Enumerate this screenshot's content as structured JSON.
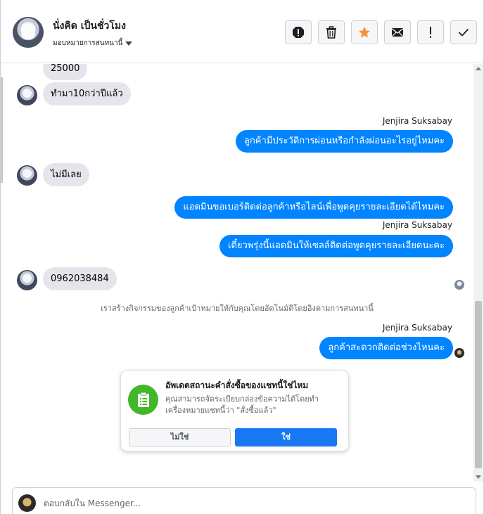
{
  "header": {
    "contact_name": "นั่งคิด เป็นชั่วโมง",
    "assign_label": "มอบหมายการสนทนานี้",
    "actions": [
      {
        "name": "spam-icon"
      },
      {
        "name": "trash-icon"
      },
      {
        "name": "star-icon",
        "color": "#f7923a"
      },
      {
        "name": "envelope-icon"
      },
      {
        "name": "exclamation-icon"
      },
      {
        "name": "checkmark-icon"
      }
    ]
  },
  "messages": [
    {
      "from": "customer",
      "text": "25000"
    },
    {
      "from": "customer",
      "text": "ทำมา10กว่าปีแล้ว"
    },
    {
      "from": "agent",
      "sender": "Jenjira Suksabay",
      "text": "ลูกค้ามีประวัติการผ่อนหรือกำลังผ่อนอะไรอยู่ไหมคะ"
    },
    {
      "from": "customer",
      "text": "ไม่มีเลย"
    },
    {
      "from": "agent",
      "text": "แอดมินขอเบอร์ติดต่อลูกค้าหรือไลน์เพื่อพูดคุยรายละเอียดได้ไหมคะ"
    },
    {
      "from": "agent",
      "sender": "Jenjira Suksabay",
      "text": "เดี๋ยวพรุ่งนี้แอดมินให้เซลล์ติดต่อพูดคุยรายละเอียดนะคะ"
    },
    {
      "from": "customer",
      "text": "0962038484"
    },
    {
      "from": "agent",
      "sender": "Jenjira Suksabay",
      "text": "ลูกค้าสะดวกติดต่อช่วงไหนคะ"
    }
  ],
  "notice": "เราสร้างกิจกรรมของลูกค้าเป้าหมายให้กับคุณโดยอัตโนมัติโดยอิงตามการสนทนานี้",
  "order_card": {
    "title": "อัพเดตสถานะคำสั่งซื้อของแชทนี้ใช่ไหม",
    "description": "คุณสามารถจัดระเบียบกล่องข้อความได้โดยทำเครื่องหมายแชทนี้ว่า \"สั่งซื้อแล้ว\"",
    "no_label": "ไม่ใช่",
    "yes_label": "ใช่",
    "icon": "order-list-icon",
    "icon_color": "#42b72a"
  },
  "composer": {
    "placeholder": "ตอบกลับใน Messenger..."
  },
  "colors": {
    "outgoing_bubble": "#0084ff",
    "incoming_bubble": "#e4e6eb",
    "primary_button": "#1877f2"
  }
}
